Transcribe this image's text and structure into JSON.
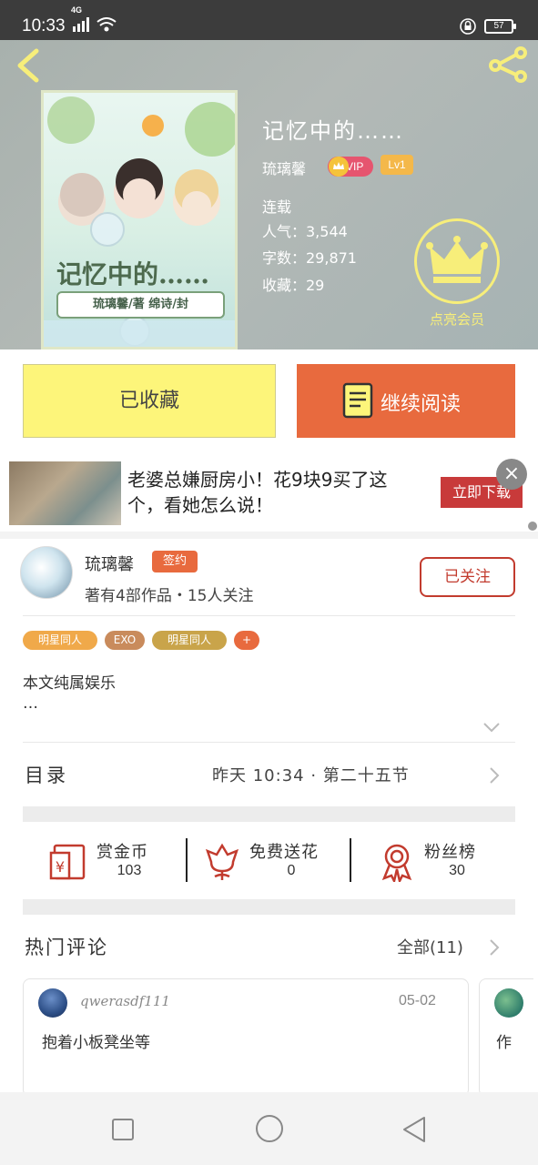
{
  "status_bar": {
    "time": "10:33",
    "network": "4G",
    "battery": "57"
  },
  "book": {
    "title": "记忆中的……",
    "author": "琉璃馨",
    "vip": "VIP",
    "level": "Lv1",
    "status": "连载",
    "popularity": "人气：3,544",
    "word_count": "字数：29,871",
    "favorites": "收藏：29",
    "member_label": "点亮会员",
    "cover": {
      "title_art": "记忆中的……",
      "author_art": "琉璃馨/著  绵诗/封"
    }
  },
  "actions": {
    "collected": "已收藏",
    "continue_reading": "继续阅读"
  },
  "ad": {
    "text": "老婆总嫌厨房小！花9块9买了这个，看她怎么说！",
    "download": "立即下载",
    "close": "×"
  },
  "author": {
    "name": "琉璃馨",
    "sign_badge": "签约",
    "meta": "著有4部作品・15人关注",
    "follow": "已关注"
  },
  "tags": [
    {
      "label": "明星同人",
      "color": "#f0a94a"
    },
    {
      "label": "EXO",
      "color": "#c98b5c"
    },
    {
      "label": "明星同人",
      "color": "#c9a44a"
    },
    {
      "label": "+",
      "color": "#e86a3e"
    }
  ],
  "description": {
    "line1": "本文纯属娱乐",
    "line2": "…"
  },
  "catalog": {
    "label": "目录",
    "latest": "昨天 10:34 · 第二十五节"
  },
  "gifts": [
    {
      "label": "赏金币",
      "count": "103",
      "icon": "red-envelope-icon"
    },
    {
      "label": "免费送花",
      "count": "0",
      "icon": "flower-icon"
    },
    {
      "label": "粉丝榜",
      "count": "30",
      "icon": "award-icon"
    }
  ],
  "comments": {
    "label": "热门评论",
    "all": "全部(11)",
    "items": [
      {
        "user": "qwerasdf111",
        "date": "05-02",
        "text": "抱着小板凳坐等"
      },
      {
        "text": "作"
      }
    ]
  },
  "colors": {
    "accent": "#e86a3e",
    "collected_bg": "#fdf57a",
    "follow": "#c23b2e",
    "member": "#f7ee7a"
  }
}
